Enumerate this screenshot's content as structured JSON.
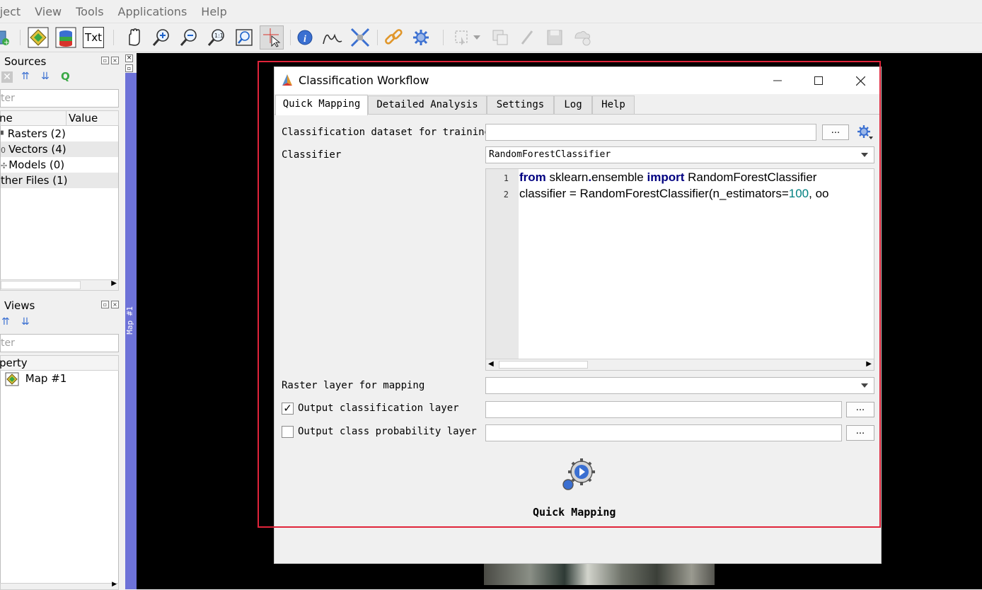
{
  "menubar": {
    "items": [
      "oject",
      "View",
      "Tools",
      "Applications",
      "Help"
    ]
  },
  "toolbar": {
    "icons": [
      "add-source-icon",
      "map-view-icon",
      "stack-icon",
      "text-icon",
      "pan-icon",
      "zoom-in-icon",
      "zoom-out-icon",
      "zoom-actual-icon",
      "zoom-full-icon",
      "select-cursor-icon",
      "info-icon",
      "spectral-profile-icon",
      "center-map-icon",
      "link-icon",
      "settings-icon",
      "select-features-icon",
      "copy-icon",
      "edit-icon",
      "save-icon",
      "add-layer-icon"
    ],
    "text_button_label": "Txt"
  },
  "data_sources": {
    "title": "a Sources",
    "filter_placeholder": "ter",
    "col_name": "ne",
    "col_value": "Value",
    "items": [
      {
        "label": "Rasters (2)"
      },
      {
        "label": "Vectors (4)"
      },
      {
        "label": "Models (0)"
      },
      {
        "label": "ther Files (1)"
      }
    ]
  },
  "data_views": {
    "title": "a Views",
    "filter_placeholder": "ter",
    "col_property": "perty",
    "items": [
      {
        "label": "Map #1"
      }
    ]
  },
  "map_strip": {
    "label": "Map #1"
  },
  "dialog": {
    "title": "Classification Workflow",
    "tabs": [
      "Quick Mapping",
      "Detailed Analysis",
      "Settings",
      "Log",
      "Help"
    ],
    "selected_tab": "Quick Mapping",
    "training_label": "Classification dataset for training",
    "training_value": "",
    "browse_label": "...",
    "classifier_label": "Classifier",
    "classifier_value": "RandomForestClassifier",
    "code": {
      "line_numbers": [
        "1",
        "2"
      ],
      "line1": {
        "kw1": "from",
        "t1": " sklearn",
        "op": ".",
        "t2": "ensemble ",
        "kw2": "import",
        "t3": " RandomForestClassifier"
      },
      "line2": {
        "t1": "classifier = RandomForestClassifier(",
        "t2": "n_estimators=",
        "num": "100",
        "t3": ", oo"
      }
    },
    "raster_label": "Raster layer for mapping",
    "raster_value": "",
    "output_class_label": "Output classification layer",
    "output_class_checked": "✓",
    "output_class_value": "",
    "output_prob_label": "Output class probability layer",
    "output_prob_checked": "",
    "output_prob_value": "",
    "run_label": "Quick Mapping"
  },
  "colors": {
    "highlight_border": "#e0243a",
    "map_strip": "#6d72d8",
    "keyword": "#000080",
    "number": "#008080"
  }
}
